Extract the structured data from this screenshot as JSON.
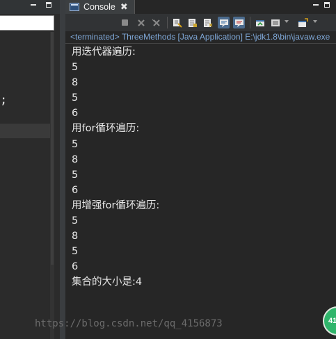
{
  "console": {
    "tab_label": "Console",
    "tab_close_glyph": "✖",
    "status_line": "<terminated> ThreeMethods [Java Application] E:\\jdk1.8\\bin\\javaw.exe",
    "output_lines": [
      "用迭代器遍历:",
      "5",
      "8",
      "5",
      "6",
      "用for循环遍历:",
      "5",
      "8",
      "5",
      "6",
      "用增强for循环遍历:",
      "5",
      "8",
      "5",
      "6",
      "集合的大小是:4"
    ]
  },
  "editor": {
    "visible_fragment": ";"
  },
  "toolbar": {
    "icons": [
      "terminate-icon",
      "remove-launch-icon",
      "remove-all-terminated-icon",
      "clear-console-icon",
      "scroll-lock-icon",
      "word-wrap-icon",
      "show-stdout-icon",
      "show-stderr-icon",
      "pin-console-icon",
      "display-selected-console-icon",
      "open-console-icon"
    ]
  },
  "watermark": "https://blog.csdn.net/qq_4156873",
  "badge": "41",
  "colors": {
    "background": "#262626",
    "status_text": "#7fa8d8",
    "output_text": "#e8e8e8",
    "watermark": "#6c6c6c",
    "badge": "#2fb56b"
  }
}
